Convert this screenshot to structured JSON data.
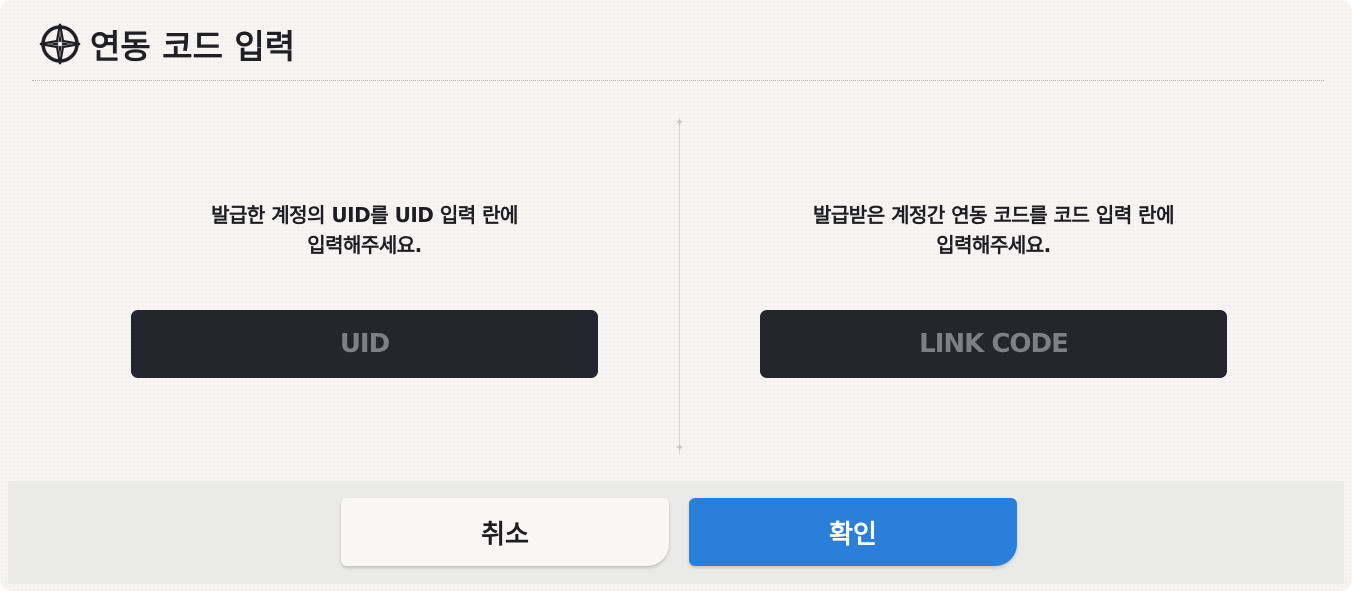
{
  "dialog": {
    "title": "연동 코드 입력",
    "logo_icon": "compass-star-icon"
  },
  "left_panel": {
    "instruction_line1": "발급한 계정의 UID를 UID 입력 란에",
    "instruction_line2": "입력해주세요.",
    "input_placeholder": "UID",
    "input_value": ""
  },
  "right_panel": {
    "instruction_line1": "발급받은 계정간 연동 코드를 코드 입력 란에",
    "instruction_line2": "입력해주세요.",
    "input_placeholder": "LINK CODE",
    "input_value": ""
  },
  "footer": {
    "cancel_label": "취소",
    "confirm_label": "확인"
  },
  "colors": {
    "confirm_button": "#2a7fdb",
    "input_background": "#24252d",
    "dialog_background": "#f6f5f3"
  }
}
